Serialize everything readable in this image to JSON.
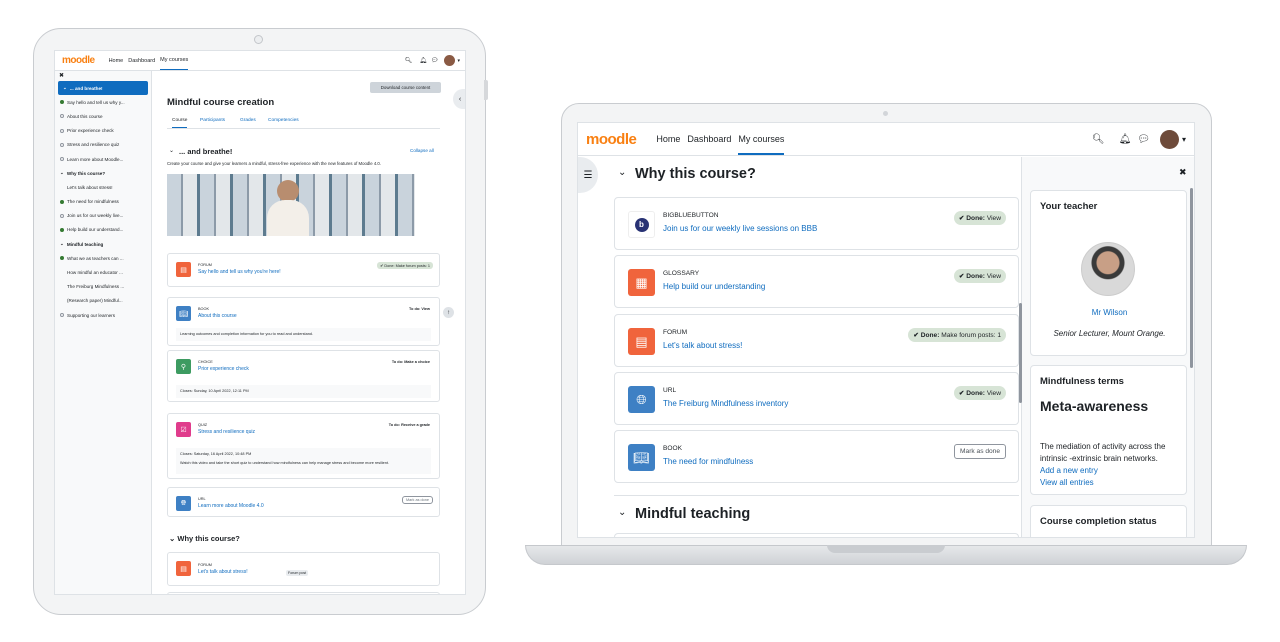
{
  "brand": "moodle",
  "nav": {
    "home": "Home",
    "dashboard": "Dashboard",
    "my_courses": "My courses"
  },
  "tablet": {
    "close": "✖",
    "sidebar": [
      {
        "label": "... and breathe!",
        "state": "section-active"
      },
      {
        "label": "Say hello and tell us why y...",
        "state": "done"
      },
      {
        "label": "About this course",
        "state": "todo"
      },
      {
        "label": "Prior experience check",
        "state": "todo"
      },
      {
        "label": "Stress and resilience quiz",
        "state": "todo"
      },
      {
        "label": "Learn more about Moodle...",
        "state": "todo"
      },
      {
        "label": "Why this course?",
        "state": "section"
      },
      {
        "label": "Let's talk about stress!",
        "state": "none"
      },
      {
        "label": "The need for mindfulness",
        "state": "done"
      },
      {
        "label": "Join us for our weekly live...",
        "state": "todo"
      },
      {
        "label": "Help build our understand...",
        "state": "done"
      },
      {
        "label": "Mindful teaching",
        "state": "section"
      },
      {
        "label": "What we as teachers can ...",
        "state": "done"
      },
      {
        "label": "How mindful an educator ...",
        "state": "none"
      },
      {
        "label": "The Freiburg Mindfulness ...",
        "state": "none"
      },
      {
        "label": "(Research paper) Mindful...",
        "state": "none"
      },
      {
        "label": "Supporting our learners",
        "state": "todo"
      }
    ],
    "download_btn": "Download course content",
    "course_title": "Mindful course creation",
    "tabs": [
      "Course",
      "Participants",
      "Grades",
      "Competencies"
    ],
    "section1_title": "... and breathe!",
    "collapse_all": "Collapse all",
    "section1_desc": "Create your course and give your learners a mindful, stress-free experience with the new features of Moodle 4.0.",
    "activities": [
      {
        "type": "FORUM",
        "title": "Say hello and tell us why you're here!",
        "badge": "✔ Done: Make forum posts: 1"
      },
      {
        "type": "BOOK",
        "title": "About this course",
        "badge": "To do: View",
        "note": "Learning outcomes and completion information for you to read and understand."
      },
      {
        "type": "CHOICE",
        "title": "Prior experience check",
        "badge": "To do: Make a choice",
        "note": "Closes: Sunday, 10 April 2022, 12:11 PM"
      },
      {
        "type": "QUIZ",
        "title": "Stress and resilience quiz",
        "badge": "To do: Receive a grade",
        "note": "Closes: Saturday, 16 April 2022, 10:48 PM",
        "note2": "Watch this video and take the short quiz to understand how mindfulness can help manage stress and become more resilient."
      },
      {
        "type": "URL",
        "title": "Learn more about Moodle 4.0",
        "badge": "Mark as done"
      }
    ],
    "section2_title": "Why this course?",
    "forum2": {
      "type": "FORUM",
      "title": "Let's talk about stress!",
      "badge": "Forum post"
    }
  },
  "laptop": {
    "section1_title": "Why this course?",
    "activities": [
      {
        "type": "BIGBLUEBUTTON",
        "title": "Join us for our weekly live sessions on BBB",
        "badge": "Done:",
        "badge_rest": "View"
      },
      {
        "type": "GLOSSARY",
        "title": "Help build our understanding",
        "badge": "Done:",
        "badge_rest": "View"
      },
      {
        "type": "FORUM",
        "title": "Let's talk about stress!",
        "badge": "Done:",
        "badge_rest": "Make forum posts: 1"
      },
      {
        "type": "URL",
        "title": "The Freiburg Mindfulness inventory",
        "badge": "Done:",
        "badge_rest": "View"
      },
      {
        "type": "BOOK",
        "title": "The need for mindfulness",
        "badge": "Mark as done"
      }
    ],
    "section2_title": "Mindful teaching",
    "close": "✖",
    "teacher_block": {
      "title": "Your teacher",
      "name": "Mr Wilson",
      "role": "Senior Lecturer, Mount Orange."
    },
    "terms_block": {
      "title": "Mindfulness terms",
      "term": "Meta-awareness",
      "definition": "The mediation of activity across the intrinsic -extrinsic brain networks.",
      "add": "Add a new entry",
      "view": "View all entries"
    },
    "completion_block": {
      "title": "Course completion status"
    }
  }
}
